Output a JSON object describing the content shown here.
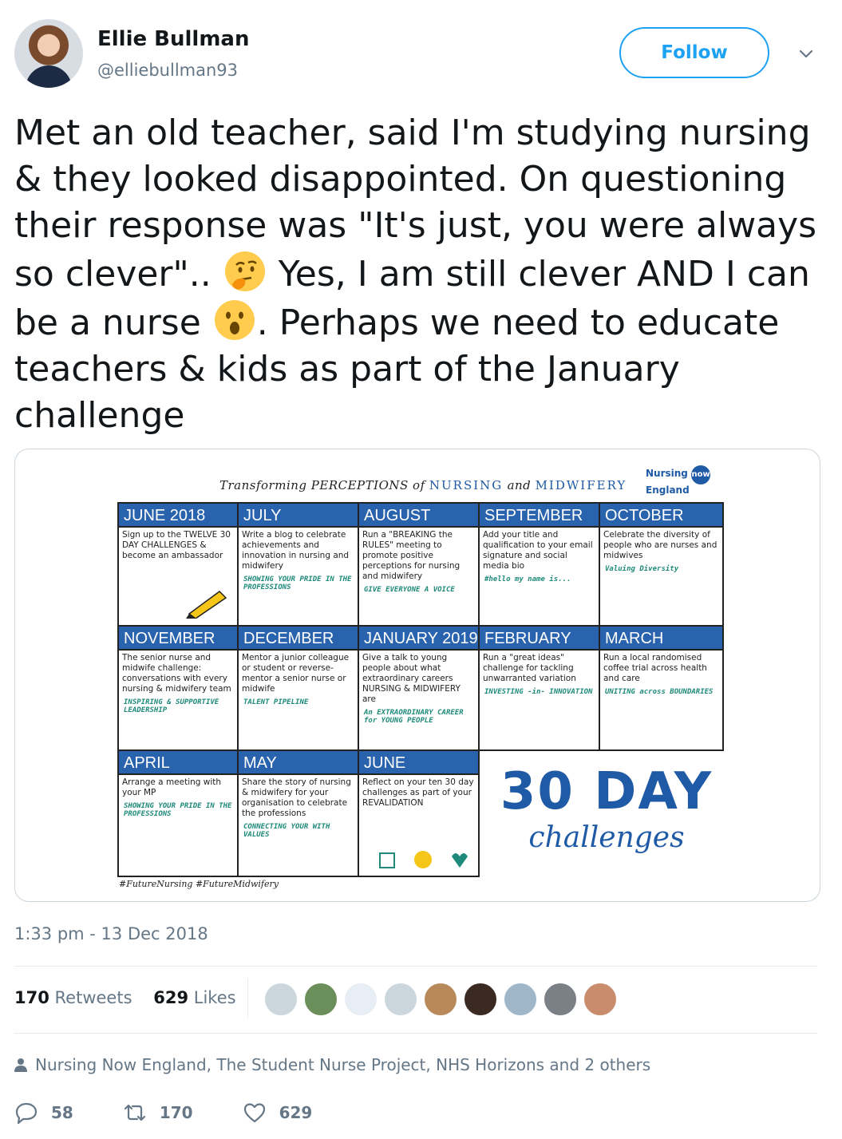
{
  "author": {
    "name": "Ellie Bullman",
    "handle": "@elliebullman93"
  },
  "follow_label": "Follow",
  "tweet": {
    "part1": "Met an old teacher, said I'm studying nursing & they looked disappointed. On questioning their response was \"It's just, you were always so clever\"..",
    "part2": "Yes, I am still clever AND I can be a nurse",
    "part3": ". Perhaps we need to educate teachers & kids as part of the January challenge",
    "emoji1": "thinking-face",
    "emoji2": "face-with-open-mouth"
  },
  "poster": {
    "title_pre": "Transforming PERCEPTIONS of",
    "title_nursing": "NURSING",
    "title_and": "and",
    "title_midwifery": "MIDWIFERY",
    "logo_line1": "Nursing",
    "logo_now": "now",
    "logo_line2": "England",
    "cells": [
      {
        "month": "JUNE 2018",
        "task": "Sign up to the TWELVE 30 DAY CHALLENGES & become an ambassador",
        "tag": ""
      },
      {
        "month": "JULY",
        "task": "Write a blog to celebrate achievements and innovation in nursing and midwifery",
        "tag": "SHOWING YOUR PRIDE IN THE PROFESSIONS"
      },
      {
        "month": "AUGUST",
        "task": "Run a \"BREAKING the RULES\" meeting to promote positive perceptions for nursing and midwifery",
        "tag": "GIVE EVERYONE A VOICE"
      },
      {
        "month": "SEPTEMBER",
        "task": "Add your title and qualification to your email signature and social media bio",
        "tag": "#hello my name is..."
      },
      {
        "month": "OCTOBER",
        "task": "Celebrate the diversity of people who are nurses and midwives",
        "tag": "Valuing Diversity"
      },
      {
        "month": "NOVEMBER",
        "task": "The senior nurse and midwife challenge: conversations with every nursing & midwifery team",
        "tag": "INSPIRING & SUPPORTIVE LEADERSHIP"
      },
      {
        "month": "DECEMBER",
        "task": "Mentor a junior colleague or student or reverse-mentor a senior nurse or midwife",
        "tag": "TALENT PIPELINE"
      },
      {
        "month": "JANUARY 2019",
        "task": "Give a talk to young people about what extraordinary careers NURSING & MIDWIFERY are",
        "tag": "An EXTRAORDINARY CAREER for YOUNG PEOPLE"
      },
      {
        "month": "FEBRUARY",
        "task": "Run a \"great ideas\" challenge for tackling unwarranted variation",
        "tag": "INVESTING -in- INNOVATION"
      },
      {
        "month": "MARCH",
        "task": "Run a local randomised coffee trial across health and care",
        "tag": "UNITING across BOUNDARIES"
      },
      {
        "month": "APRIL",
        "task": "Arrange a meeting with your MP",
        "tag": "SHOWING YOUR PRIDE IN THE PROFESSIONS"
      },
      {
        "month": "MAY",
        "task": "Share the story of nursing & midwifery for your organisation to celebrate the professions",
        "tag": "CONNECTING YOUR WITH VALUES"
      },
      {
        "month": "JUNE",
        "task": "Reflect on your ten 30 day challenges as part of your REVALIDATION",
        "tag": ""
      }
    ],
    "big_line1": "30 DAY",
    "big_line2": "challenges",
    "hashtags": "#FutureNursing  #FutureMidwifery"
  },
  "timestamp": "1:33 pm - 13 Dec 2018",
  "stats": {
    "retweets_count": "170",
    "retweets_label": "Retweets",
    "likes_count": "629",
    "likes_label": "Likes"
  },
  "replying_to": "Nursing Now England, The Student Nurse Project, NHS Horizons and 2 others",
  "actions": {
    "replies": "58",
    "retweets": "170",
    "likes": "629"
  },
  "colors": {
    "accent": "#1da1f2",
    "poster_blue": "#2a63ad",
    "secondary_text": "#657786"
  }
}
